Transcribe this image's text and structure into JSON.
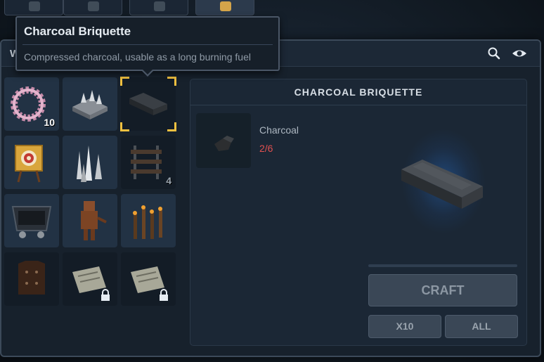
{
  "top_tabs": [
    {
      "icon": "hammer-icon",
      "active": false
    },
    {
      "icon": "sickle-icon",
      "active": false
    },
    {
      "icon": "frame-icon",
      "active": false
    },
    {
      "icon": "target-icon",
      "active": true
    }
  ],
  "window": {
    "title": "W"
  },
  "header_icons": [
    "search-icon",
    "eye-icon"
  ],
  "tooltip": {
    "title": "Charcoal Briquette",
    "description": "Compressed charcoal, usable as a long burning fuel"
  },
  "recipes": [
    {
      "name": "wreath-icon",
      "count": "10"
    },
    {
      "name": "spike-trap-icon",
      "count": ""
    },
    {
      "name": "charcoal-briquette-icon",
      "count": "",
      "selected": true
    },
    {
      "name": "archery-target-icon",
      "count": ""
    },
    {
      "name": "silver-spikes-icon",
      "count": ""
    },
    {
      "name": "rail-track-icon",
      "count": "4"
    },
    {
      "name": "minecart-icon",
      "count": ""
    },
    {
      "name": "training-dummy-icon",
      "count": ""
    },
    {
      "name": "wooden-stakes-icon",
      "count": ""
    },
    {
      "name": "leather-armor-icon",
      "count": ""
    },
    {
      "name": "scroll-blueprint-icon",
      "locked": true
    },
    {
      "name": "scroll-blueprint-icon",
      "locked": true
    }
  ],
  "detail": {
    "title": "CHARCOAL BRIQUETTE",
    "ingredient": {
      "name": "Charcoal",
      "count": "2/6",
      "count_color": "#e05050"
    },
    "craft_label": "CRAFT",
    "x10_label": "X10",
    "all_label": "ALL"
  },
  "colors": {
    "accent_selection": "#f0c040",
    "insufficient": "#e05050"
  }
}
